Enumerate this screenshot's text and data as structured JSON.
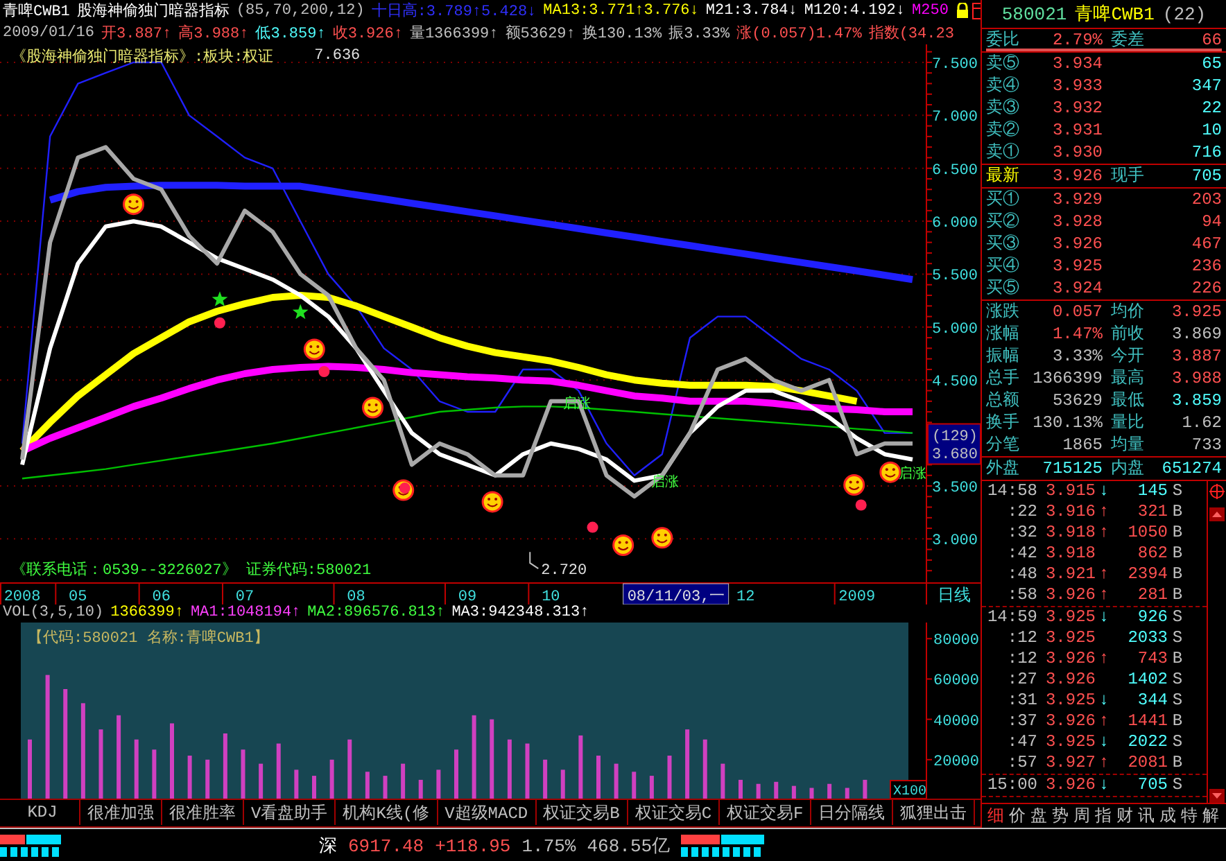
{
  "header": {
    "security": "青啤CWB1",
    "indicator": "股海神偷独门暗器指标",
    "params": "(85,70,200,12)",
    "indicator_values": [
      {
        "text": "十日高:3.789↑5.428↓",
        "color": "#3030ff"
      },
      {
        "text": "MA13:3.771↑3.776↓",
        "color": "#ffff00"
      },
      {
        "text": "M21:3.784↓",
        "color": "#ffffff"
      },
      {
        "text": "M120:4.192↓",
        "color": "#ffffff"
      },
      {
        "text": "M250",
        "color": "#ff00ff"
      }
    ],
    "date": "2009/01/16",
    "quote": [
      {
        "text": "开3.887↑",
        "color": "#ff5050"
      },
      {
        "text": "高3.988↑",
        "color": "#ff5050"
      },
      {
        "text": "低3.859↑",
        "color": "#50ffff"
      },
      {
        "text": "收3.926↑",
        "color": "#ff5050"
      },
      {
        "text": "量1366399↑",
        "color": "#c0c0c0"
      },
      {
        "text": "额53629↑",
        "color": "#c0c0c0"
      },
      {
        "text": "换130.13%",
        "color": "#c0c0c0"
      },
      {
        "text": "振3.33%",
        "color": "#c0c0c0"
      },
      {
        "text": "涨(0.057)1.47%",
        "color": "#ff5050"
      },
      {
        "text": "指数(34.23",
        "color": "#ff5050"
      }
    ]
  },
  "price_chart": {
    "overlay_title": "《股海神偷独门暗器指标》:板块:权证",
    "contact": "《联系电话：0539--3226027》 证券代码:580021",
    "period": "日线",
    "cursor": {
      "date": "08/11/03,一",
      "bar": "(129)",
      "price": "3.680"
    },
    "chart_data": {
      "type": "line",
      "grid": true,
      "categories": [
        "2008",
        null,
        "05",
        null,
        null,
        "06",
        null,
        null,
        "07",
        null,
        null,
        null,
        "08",
        null,
        null,
        null,
        "09",
        null,
        null,
        "10",
        null,
        null,
        null,
        null,
        null,
        null,
        "12",
        null,
        null,
        null,
        "2009",
        null,
        null
      ],
      "ylim": [
        2.59,
        7.67
      ],
      "yticks": [
        {
          "value": 3,
          "label": "3.000"
        },
        {
          "value": 3.5,
          "label": "3.500"
        },
        {
          "value": 4.5,
          "label": "4.500"
        },
        {
          "value": 5,
          "label": "5.000"
        },
        {
          "value": 5.5,
          "label": "5.500"
        },
        {
          "value": 6,
          "label": "6.000"
        },
        {
          "value": 6.5,
          "label": "6.500"
        },
        {
          "value": 7,
          "label": "7.000"
        },
        {
          "value": 7.5,
          "label": "7.500"
        }
      ],
      "series": [
        {
          "color": "#2020ff",
          "values": [
            3.9,
            6.8,
            7.3,
            7.4,
            7.5,
            7.5,
            7.0,
            6.8,
            6.6,
            6.5,
            6.0,
            5.5,
            5.2,
            4.8,
            4.6,
            4.3,
            4.2,
            4.2,
            4.6,
            4.6,
            4.4,
            3.9,
            3.6,
            3.8,
            4.9,
            5.1,
            5.1,
            4.9,
            4.7,
            4.6,
            4.4,
            4.0,
            4.0
          ]
        },
        {
          "color": "#00c000",
          "values": [
            3.57,
            3.6,
            3.63,
            3.66,
            3.7,
            3.74,
            3.78,
            3.82,
            3.86,
            3.9,
            3.95,
            4.0,
            4.05,
            4.1,
            4.15,
            4.2,
            4.22,
            4.24,
            4.25,
            4.25,
            4.24,
            4.22,
            4.2,
            4.18,
            4.16,
            4.14,
            4.12,
            4.1,
            4.08,
            4.06,
            4.04,
            4.02,
            4.0
          ]
        },
        {
          "color": "#2020ff",
          "values": [
            null,
            6.2,
            6.28,
            6.32,
            6.33,
            6.34,
            6.34,
            6.34,
            6.33,
            6.33,
            6.33,
            6.29,
            6.25,
            6.21,
            6.17,
            6.13,
            6.09,
            6.05,
            6.01,
            5.97,
            5.93,
            5.89,
            5.85,
            5.81,
            5.77,
            5.73,
            5.69,
            5.65,
            5.61,
            5.57,
            5.53,
            5.49,
            5.45
          ]
        },
        {
          "color": "#ffff00",
          "values": [
            3.83,
            4.1,
            4.35,
            4.55,
            4.75,
            4.9,
            5.05,
            5.15,
            5.22,
            5.28,
            5.3,
            5.28,
            5.2,
            5.1,
            5.0,
            4.9,
            4.82,
            4.76,
            4.72,
            4.68,
            4.62,
            4.55,
            4.5,
            4.47,
            4.45,
            4.45,
            4.45,
            4.44,
            4.4,
            4.35,
            4.3,
            null,
            null
          ]
        },
        {
          "color": "#ff00ff",
          "values": [
            3.83,
            3.95,
            4.05,
            4.15,
            4.25,
            4.33,
            4.42,
            4.5,
            4.56,
            4.6,
            4.62,
            4.63,
            4.62,
            4.6,
            4.57,
            4.55,
            4.53,
            4.52,
            4.5,
            4.49,
            4.45,
            4.4,
            4.35,
            4.33,
            4.3,
            4.3,
            4.3,
            4.28,
            4.25,
            4.23,
            4.22,
            4.2,
            4.2
          ]
        },
        {
          "color": "#ffffff",
          "values": [
            3.7,
            4.8,
            5.6,
            5.95,
            6.0,
            5.95,
            5.8,
            5.65,
            5.55,
            5.45,
            5.3,
            5.1,
            4.8,
            4.4,
            4.0,
            3.8,
            3.7,
            3.6,
            3.8,
            3.9,
            3.85,
            3.75,
            3.55,
            3.6,
            4.0,
            4.25,
            4.4,
            4.4,
            4.3,
            4.15,
            3.95,
            3.8,
            3.75
          ]
        },
        {
          "color": "#a8a8a8",
          "values": [
            3.75,
            5.8,
            6.6,
            6.7,
            6.4,
            6.3,
            5.86,
            5.6,
            6.1,
            5.9,
            5.5,
            5.3,
            4.8,
            4.5,
            3.7,
            3.9,
            3.8,
            3.6,
            3.6,
            4.3,
            4.3,
            3.6,
            3.4,
            3.6,
            4.0,
            4.6,
            4.7,
            4.5,
            4.4,
            4.5,
            3.8,
            3.9,
            3.9
          ]
        }
      ],
      "annotations": [
        "7.636",
        "2.720",
        "启涨",
        "启涨",
        "启涨"
      ]
    }
  },
  "volume": {
    "legend": [
      {
        "text": "VOL(3,5,10)",
        "color": "#c0c0c0"
      },
      {
        "text": "1366399↑",
        "color": "#ffff00"
      },
      {
        "text": "MA1:1048194↑",
        "color": "#ff40ff"
      },
      {
        "text": "MA2:896576.813↑",
        "color": "#40ff40"
      },
      {
        "text": "MA3:942348.313↑",
        "color": "#ffffff"
      }
    ],
    "panel_title": "【代码:580021 名称:青啤CWB1】",
    "chart_data": {
      "type": "bar",
      "ylabel": "X100",
      "ylim": [
        0,
        88000
      ],
      "yticks": [
        20000,
        40000,
        60000,
        80000
      ],
      "series": [
        {
          "color": "#d040c0",
          "values": [
            30000,
            62000,
            55000,
            48000,
            35000,
            42000,
            30000,
            25000,
            38000,
            22000,
            20000,
            33000,
            25000,
            18000,
            28000,
            15000,
            12000,
            20000,
            30000,
            14000,
            12000,
            18000,
            10000,
            15000,
            25000,
            42000,
            40000,
            30000,
            28000,
            20000,
            15000,
            32000,
            22000,
            18000,
            14000,
            12000,
            22000,
            35000,
            30000,
            18000,
            10000,
            8000,
            9000,
            7000,
            6000,
            8000,
            6000,
            10000
          ]
        }
      ]
    }
  },
  "indicator_tabs": [
    {
      "label": "KDJ",
      "selected": false
    },
    {
      "label": "很准加强",
      "selected": false
    },
    {
      "label": "很准胜率",
      "selected": false
    },
    {
      "label": "V看盘助手",
      "selected": false
    },
    {
      "label": "机构K线(修",
      "selected": false
    },
    {
      "label": "V超级MACD",
      "selected": false
    },
    {
      "label": "权证交易B",
      "selected": false
    },
    {
      "label": "权证交易C",
      "selected": false
    },
    {
      "label": "权证交易F",
      "selected": false
    },
    {
      "label": "日分隔线",
      "selected": false
    },
    {
      "label": "狐狸出击",
      "selected": false
    }
  ],
  "quote_panel": {
    "code": "580021",
    "name": "青啤CWB1",
    "count": "(22)",
    "ratio": {
      "label": "委比",
      "value": "2.79%",
      "label2": "委差",
      "value2": "66"
    },
    "asks": [
      {
        "label": "卖⑤",
        "price": "3.934",
        "volume": "65"
      },
      {
        "label": "卖④",
        "price": "3.933",
        "volume": "347"
      },
      {
        "label": "卖③",
        "price": "3.932",
        "volume": "22"
      },
      {
        "label": "卖②",
        "price": "3.931",
        "volume": "10"
      },
      {
        "label": "卖①",
        "price": "3.930",
        "volume": "716"
      }
    ],
    "last": {
      "label": "最新",
      "price": "3.926",
      "label2": "现手",
      "value2": "705"
    },
    "bids": [
      {
        "label": "买①",
        "price": "3.929",
        "volume": "203"
      },
      {
        "label": "买②",
        "price": "3.928",
        "volume": "94"
      },
      {
        "label": "买③",
        "price": "3.926",
        "volume": "467"
      },
      {
        "label": "买④",
        "price": "3.925",
        "volume": "236"
      },
      {
        "label": "买⑤",
        "price": "3.924",
        "volume": "226"
      }
    ],
    "stats": [
      {
        "left": {
          "label": "涨跌",
          "value": "0.057",
          "color": "#ff5050"
        },
        "right": {
          "label": "均价",
          "value": "3.925",
          "color": "#ff5050"
        }
      },
      {
        "left": {
          "label": "涨幅",
          "value": "1.47%",
          "color": "#ff5050"
        },
        "right": {
          "label": "前收",
          "value": "3.869",
          "color": "#c0c0c0"
        }
      },
      {
        "left": {
          "label": "振幅",
          "value": "3.33%",
          "color": "#c0c0c0"
        },
        "right": {
          "label": "今开",
          "value": "3.887",
          "color": "#ff5050"
        }
      },
      {
        "left": {
          "label": "总手",
          "value": "1366399",
          "color": "#c0c0c0"
        },
        "right": {
          "label": "最高",
          "value": "3.988",
          "color": "#ff5050"
        }
      },
      {
        "left": {
          "label": "总额",
          "value": "53629",
          "color": "#c0c0c0"
        },
        "right": {
          "label": "最低",
          "value": "3.859",
          "color": "#50ffff"
        }
      },
      {
        "left": {
          "label": "换手",
          "value": "130.13%",
          "color": "#c0c0c0"
        },
        "right": {
          "label": "量比",
          "value": "1.62",
          "color": "#c0c0c0"
        }
      },
      {
        "left": {
          "label": "分笔",
          "value": "1865",
          "color": "#c0c0c0"
        },
        "right": {
          "label": "均量",
          "value": "733",
          "color": "#c0c0c0"
        }
      }
    ],
    "outer": {
      "label": "外盘",
      "value": "715125",
      "label2": "内盘",
      "value2": "651274"
    },
    "tick_groups": [
      [
        {
          "time": "14:58",
          "price": "3.915",
          "arrow": "↓",
          "volume": "145",
          "side": "S",
          "kind": "sell"
        },
        {
          "time": ":22",
          "price": "3.916",
          "arrow": "↑",
          "volume": "321",
          "side": "B",
          "kind": "buy"
        },
        {
          "time": ":32",
          "price": "3.918",
          "arrow": "↑",
          "volume": "1050",
          "side": "B",
          "kind": "buy"
        },
        {
          "time": ":42",
          "price": "3.918",
          "volume": "862",
          "side": "B",
          "kind": "buy"
        },
        {
          "time": ":48",
          "price": "3.921",
          "arrow": "↑",
          "volume": "2394",
          "side": "B",
          "kind": "buy"
        },
        {
          "time": ":58",
          "price": "3.926",
          "arrow": "↑",
          "volume": "281",
          "side": "B",
          "kind": "buy"
        }
      ],
      [
        {
          "time": "14:59",
          "price": "3.925",
          "arrow": "↓",
          "volume": "926",
          "side": "S",
          "kind": "sell"
        },
        {
          "time": ":12",
          "price": "3.925",
          "volume": "2033",
          "side": "S",
          "kind": "sell"
        },
        {
          "time": ":12",
          "price": "3.926",
          "arrow": "↑",
          "volume": "743",
          "side": "B",
          "kind": "buy"
        },
        {
          "time": ":27",
          "price": "3.926",
          "volume": "1402",
          "side": "S",
          "kind": "sell"
        },
        {
          "time": ":31",
          "price": "3.925",
          "arrow": "↓",
          "volume": "344",
          "side": "S",
          "kind": "sell"
        },
        {
          "time": ":37",
          "price": "3.926",
          "arrow": "↑",
          "volume": "1441",
          "side": "B",
          "kind": "buy"
        },
        {
          "time": ":47",
          "price": "3.925",
          "arrow": "↓",
          "volume": "2022",
          "side": "S",
          "kind": "sell"
        },
        {
          "time": ":57",
          "price": "3.927",
          "arrow": "↑",
          "volume": "2081",
          "side": "B",
          "kind": "buy"
        }
      ],
      [
        {
          "time": "15:00",
          "price": "3.926",
          "arrow": "↓",
          "volume": "705",
          "side": "S",
          "kind": "sell"
        }
      ]
    ],
    "tabs": [
      {
        "label": "细",
        "selected": true
      },
      {
        "label": "价",
        "selected": false
      },
      {
        "label": "盘",
        "selected": false
      },
      {
        "label": "势",
        "selected": false
      },
      {
        "label": "周",
        "selected": false
      },
      {
        "label": "指",
        "selected": false
      },
      {
        "label": "财",
        "selected": false
      },
      {
        "label": "讯",
        "selected": false
      },
      {
        "label": "成",
        "selected": false
      },
      {
        "label": "特",
        "selected": false
      },
      {
        "label": "解",
        "selected": false
      }
    ]
  },
  "status_bar": {
    "exchange": "深",
    "index": "6917.48",
    "change": "+118.95",
    "percent": "1.75%",
    "amount": "468.55亿"
  }
}
